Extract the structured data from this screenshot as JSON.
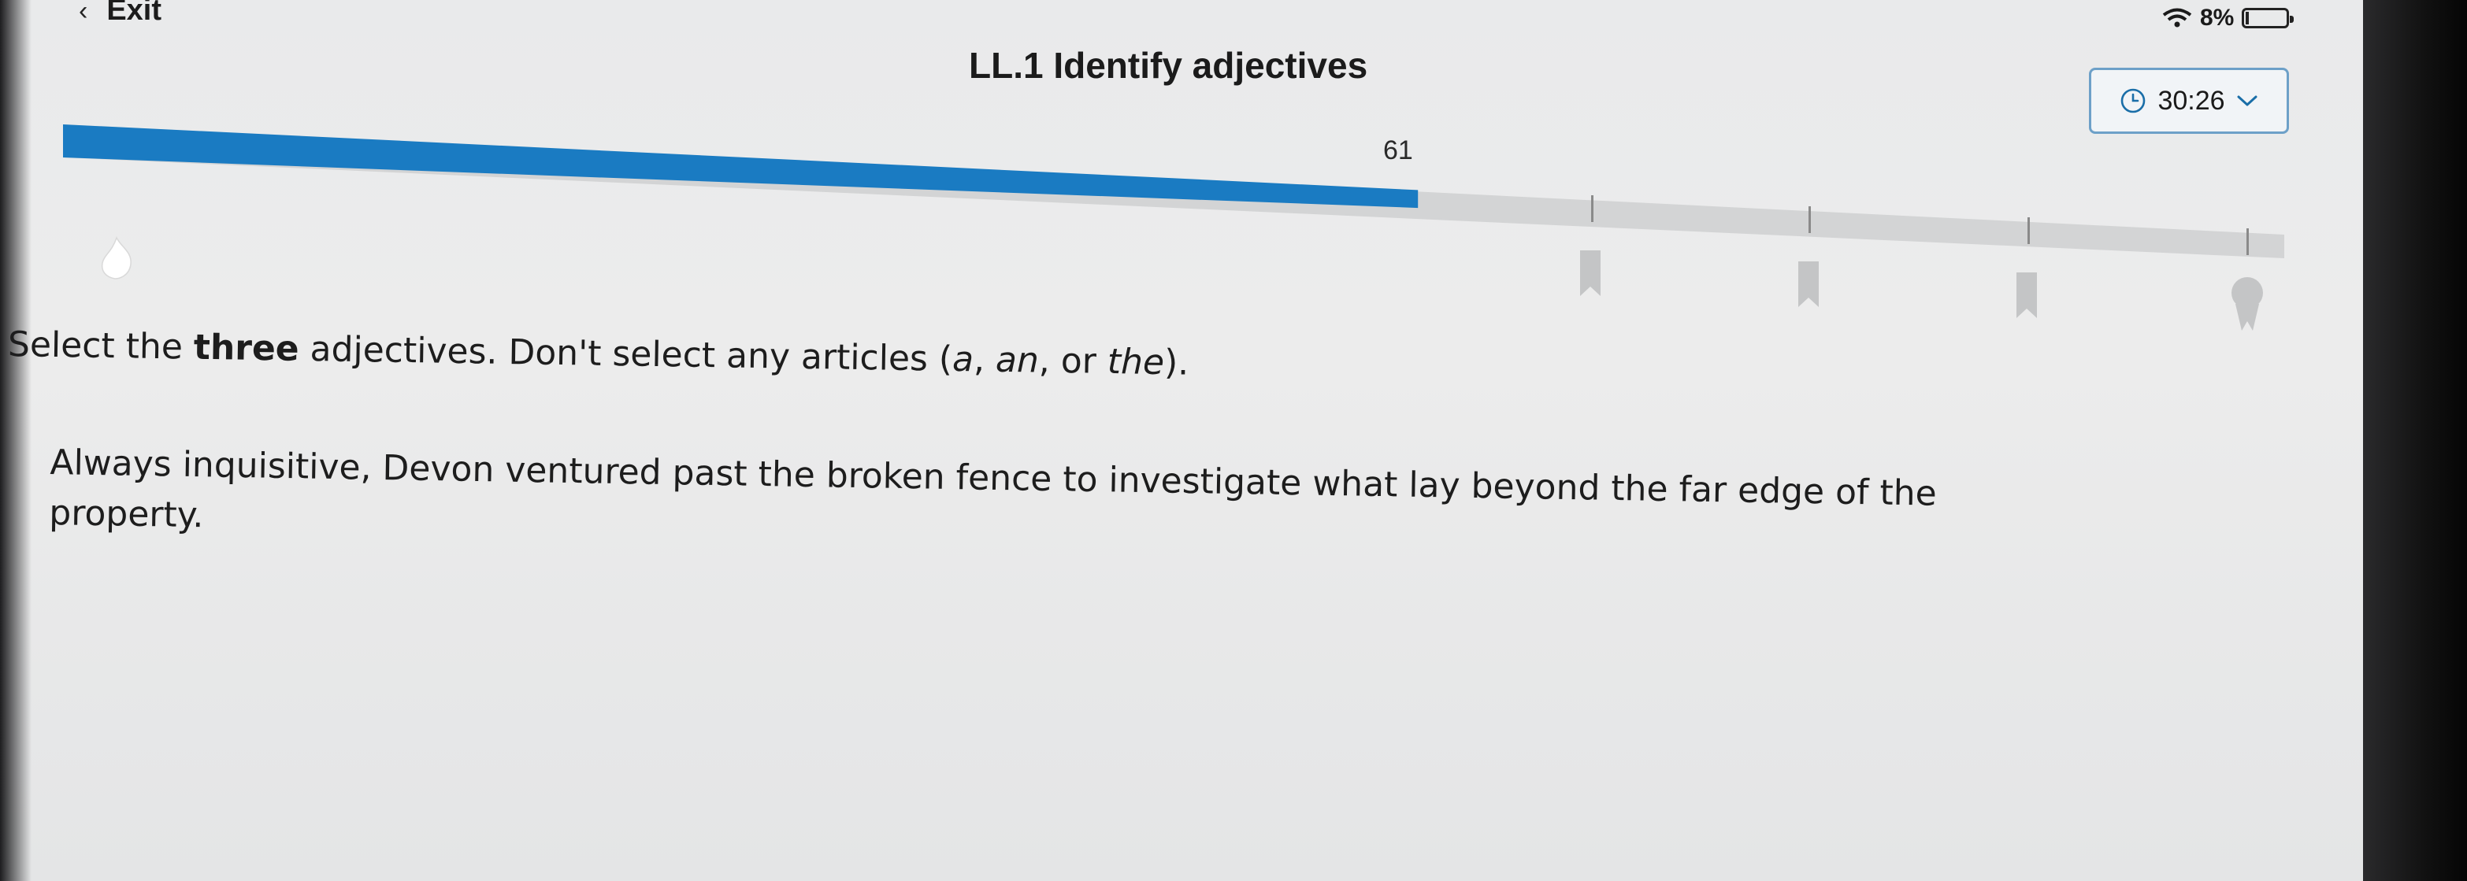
{
  "header": {
    "exit_label": "Exit",
    "title": "LL.1 Identify adjectives",
    "battery_percent": "8%",
    "timer": "30:26"
  },
  "progress": {
    "score_label": "61",
    "fraction": 0.61,
    "accent_color": "#1a7bc2",
    "track_color": "#d3d4d5"
  },
  "question": {
    "instruction": {
      "before": "Select the ",
      "emphasis": "three",
      "middle": " adjectives. Don't select any articles (",
      "article_a": "a",
      "sep1": ", ",
      "article_an": "an",
      "sep2": ", or ",
      "article_the": "the",
      "after": ")."
    },
    "words": [
      "Always",
      "inquisitive,",
      "Devon",
      "ventured",
      "past",
      "the",
      "broken",
      "fence",
      "to",
      "investigate",
      "what",
      "lay",
      "beyond",
      "the",
      "far",
      "edge",
      "of",
      "the",
      "property."
    ]
  },
  "icons": {
    "back": "chevron-left-icon",
    "wifi": "wifi-icon",
    "battery": "battery-icon",
    "clock": "clock-icon",
    "dropdown": "chevron-down-icon",
    "flame": "flame-icon",
    "milestones": [
      "ribbon-icon",
      "ribbon-icon",
      "ribbon-icon",
      "award-icon"
    ]
  }
}
